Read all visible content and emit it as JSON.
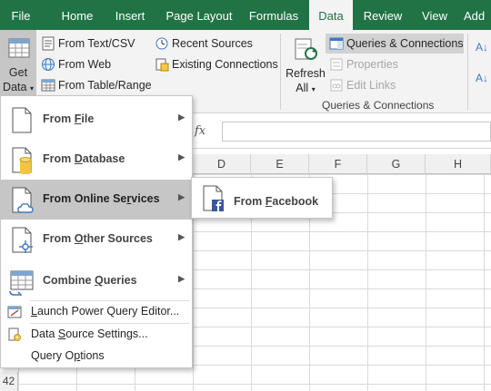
{
  "ribbon_tabs": [
    {
      "label": "File"
    },
    {
      "label": "Home"
    },
    {
      "label": "Insert"
    },
    {
      "label": "Page Layout"
    },
    {
      "label": "Formulas"
    },
    {
      "label": "Data"
    },
    {
      "label": "Review"
    },
    {
      "label": "View"
    },
    {
      "label": "Add"
    }
  ],
  "active_tab": "Data",
  "get_data": {
    "line1": "Get",
    "line2": "Data"
  },
  "get_transform": {
    "from_text_csv": "From Text/CSV",
    "from_web": "From Web",
    "from_table_range": "From Table/Range",
    "recent_sources": "Recent Sources",
    "existing_connections": "Existing Connections"
  },
  "refresh_all": {
    "line1": "Refresh",
    "line2": "All"
  },
  "queries_group": {
    "queries_connections": "Queries & Connections",
    "properties": "Properties",
    "edit_links": "Edit Links",
    "group_label": "Queries & Connections"
  },
  "sort_partial": "A↓",
  "formula_bar": {
    "fx": "fx"
  },
  "columns": [
    "D",
    "E",
    "F",
    "G",
    "H"
  ],
  "row_number": "42",
  "menu": {
    "items": [
      {
        "pre": "From ",
        "ul": "F",
        "post": "ile",
        "has_arrow": true
      },
      {
        "pre": "From ",
        "ul": "D",
        "post": "atabase",
        "has_arrow": true
      },
      {
        "pre": "From Online Se",
        "ul": "r",
        "post": "vices",
        "has_arrow": true
      },
      {
        "pre": "From ",
        "ul": "O",
        "post": "ther Sources",
        "has_arrow": true
      },
      {
        "pre": "Combine ",
        "ul": "Q",
        "post": "ueries",
        "has_arrow": true
      }
    ],
    "launch_editor": {
      "pre": "",
      "ul": "L",
      "post": "aunch Power Query Editor..."
    },
    "data_source_settings": {
      "pre": "Data ",
      "ul": "S",
      "post": "ource Settings..."
    },
    "query_options": {
      "pre": "Query O",
      "ul": "p",
      "post": "tions"
    }
  },
  "submenu": {
    "pre": "From ",
    "ul": "F",
    "post": "acebook"
  },
  "colors": {
    "accent": "#217346",
    "hover": "#c6c6c6",
    "ribbon": "#f3f3f3",
    "facebook": "#3b5998"
  }
}
